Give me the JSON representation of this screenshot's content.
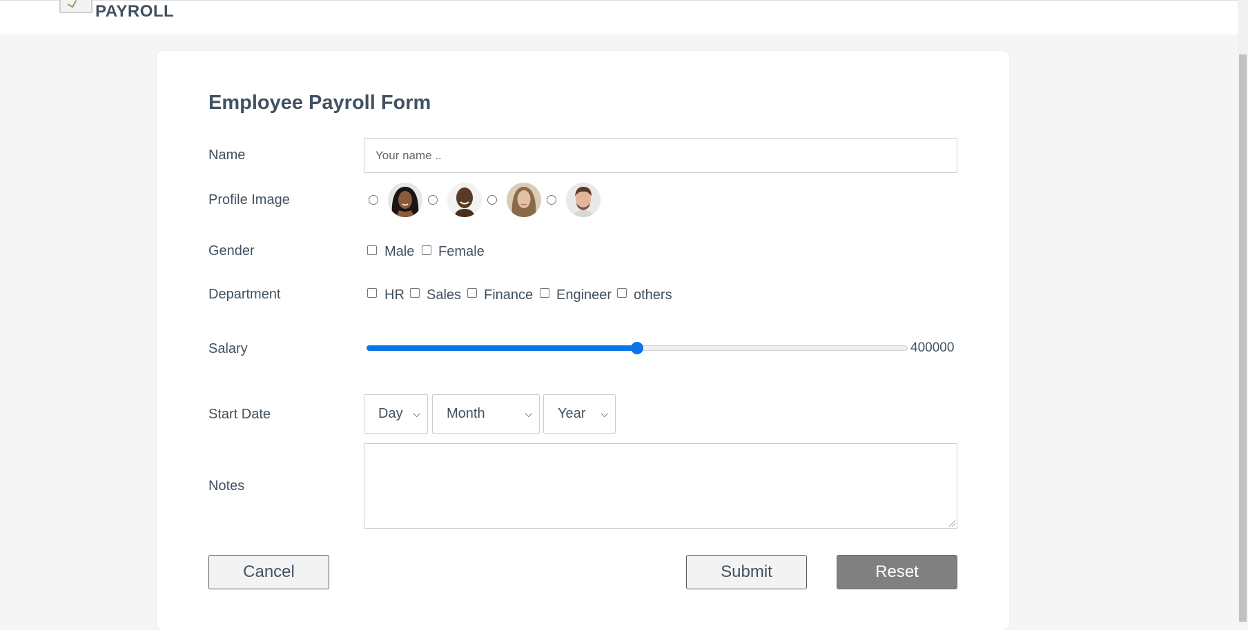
{
  "header": {
    "logo_text": "PAYROLL"
  },
  "form": {
    "title": "Employee Payroll Form",
    "name": {
      "label": "Name",
      "placeholder": "Your name ..",
      "value": ""
    },
    "profile_image": {
      "label": "Profile Image",
      "options": [
        {
          "icon": "avatar-woman-dark-hair-icon",
          "selected": false
        },
        {
          "icon": "avatar-man-bald-icon",
          "selected": false
        },
        {
          "icon": "avatar-woman-light-hair-icon",
          "selected": false
        },
        {
          "icon": "avatar-man-brown-hair-icon",
          "selected": false
        }
      ]
    },
    "gender": {
      "label": "Gender",
      "options": [
        "Male",
        "Female"
      ]
    },
    "department": {
      "label": "Department",
      "options": [
        "HR",
        "Sales",
        "Finance",
        "Engineer",
        "others"
      ]
    },
    "salary": {
      "label": "Salary",
      "value_text": "400000",
      "fraction": 0.5
    },
    "start_date": {
      "label": "Start Date",
      "day": "Day",
      "month": "Month",
      "year": "Year"
    },
    "notes": {
      "label": "Notes",
      "value": ""
    },
    "buttons": {
      "cancel": "Cancel",
      "submit": "Submit",
      "reset": "Reset"
    }
  },
  "colors": {
    "accent": "#0a74e8",
    "text": "#42515f",
    "reset_button": "#808080"
  }
}
